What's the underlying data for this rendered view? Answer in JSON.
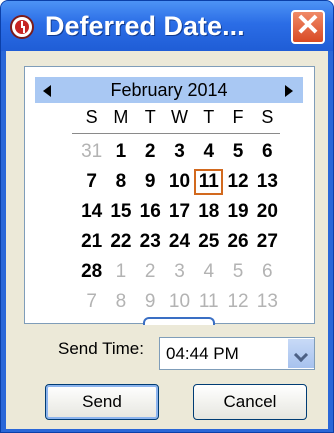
{
  "window": {
    "title": "Deferred Date...",
    "close_glyph": "✕",
    "icon": "clock-icon",
    "accent": "#2b6de6"
  },
  "calendar": {
    "month_label": "February 2014",
    "days_of_week": [
      "S",
      "M",
      "T",
      "W",
      "T",
      "F",
      "S"
    ],
    "selected_day": "11",
    "weeks": [
      [
        {
          "d": "31",
          "o": true
        },
        {
          "d": "1"
        },
        {
          "d": "2"
        },
        {
          "d": "3"
        },
        {
          "d": "4"
        },
        {
          "d": "5"
        },
        {
          "d": "6"
        }
      ],
      [
        {
          "d": "7"
        },
        {
          "d": "8"
        },
        {
          "d": "9"
        },
        {
          "d": "10"
        },
        {
          "d": "11",
          "today": true
        },
        {
          "d": "12"
        },
        {
          "d": "13"
        }
      ],
      [
        {
          "d": "14"
        },
        {
          "d": "15"
        },
        {
          "d": "16"
        },
        {
          "d": "17"
        },
        {
          "d": "18"
        },
        {
          "d": "19"
        },
        {
          "d": "20"
        }
      ],
      [
        {
          "d": "21"
        },
        {
          "d": "22"
        },
        {
          "d": "23"
        },
        {
          "d": "24"
        },
        {
          "d": "25"
        },
        {
          "d": "26"
        },
        {
          "d": "27"
        }
      ],
      [
        {
          "d": "28"
        },
        {
          "d": "1",
          "o": true
        },
        {
          "d": "2",
          "o": true
        },
        {
          "d": "3",
          "o": true
        },
        {
          "d": "4",
          "o": true
        },
        {
          "d": "5",
          "o": true
        },
        {
          "d": "6",
          "o": true
        }
      ],
      [
        {
          "d": "7",
          "o": true
        },
        {
          "d": "8",
          "o": true
        },
        {
          "d": "9",
          "o": true
        },
        {
          "d": "10",
          "o": true
        },
        {
          "d": "11",
          "o": true
        },
        {
          "d": "12",
          "o": true
        },
        {
          "d": "13",
          "o": true
        }
      ]
    ]
  },
  "send_time": {
    "label": "Send Time:",
    "value": "04:44 PM"
  },
  "buttons": {
    "send": "Send",
    "cancel": "Cancel"
  }
}
